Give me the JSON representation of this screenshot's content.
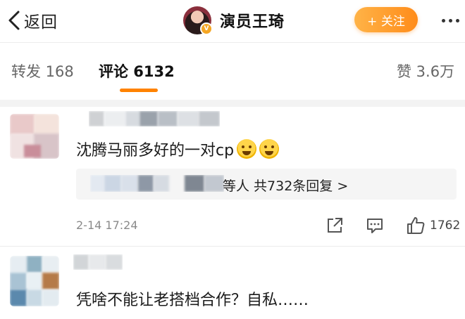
{
  "header": {
    "back_label": "返回",
    "username": "演员王琦",
    "follow_label": "+ 关注"
  },
  "tabs": [
    {
      "label": "转发 168"
    },
    {
      "label": "评论 6132"
    },
    {
      "label": "赞 3.6万"
    }
  ],
  "accent_color": "#ff8200",
  "comments": [
    {
      "text": "沈腾马丽多好的一对cp",
      "emoji": [
        "smile-emoji",
        "smile-emoji"
      ],
      "reply_summary": "等人  共732条回复 >",
      "time": "2-14 17:24",
      "likes": "1762"
    },
    {
      "text": "凭啥不能让老搭档合作？自私……"
    }
  ]
}
